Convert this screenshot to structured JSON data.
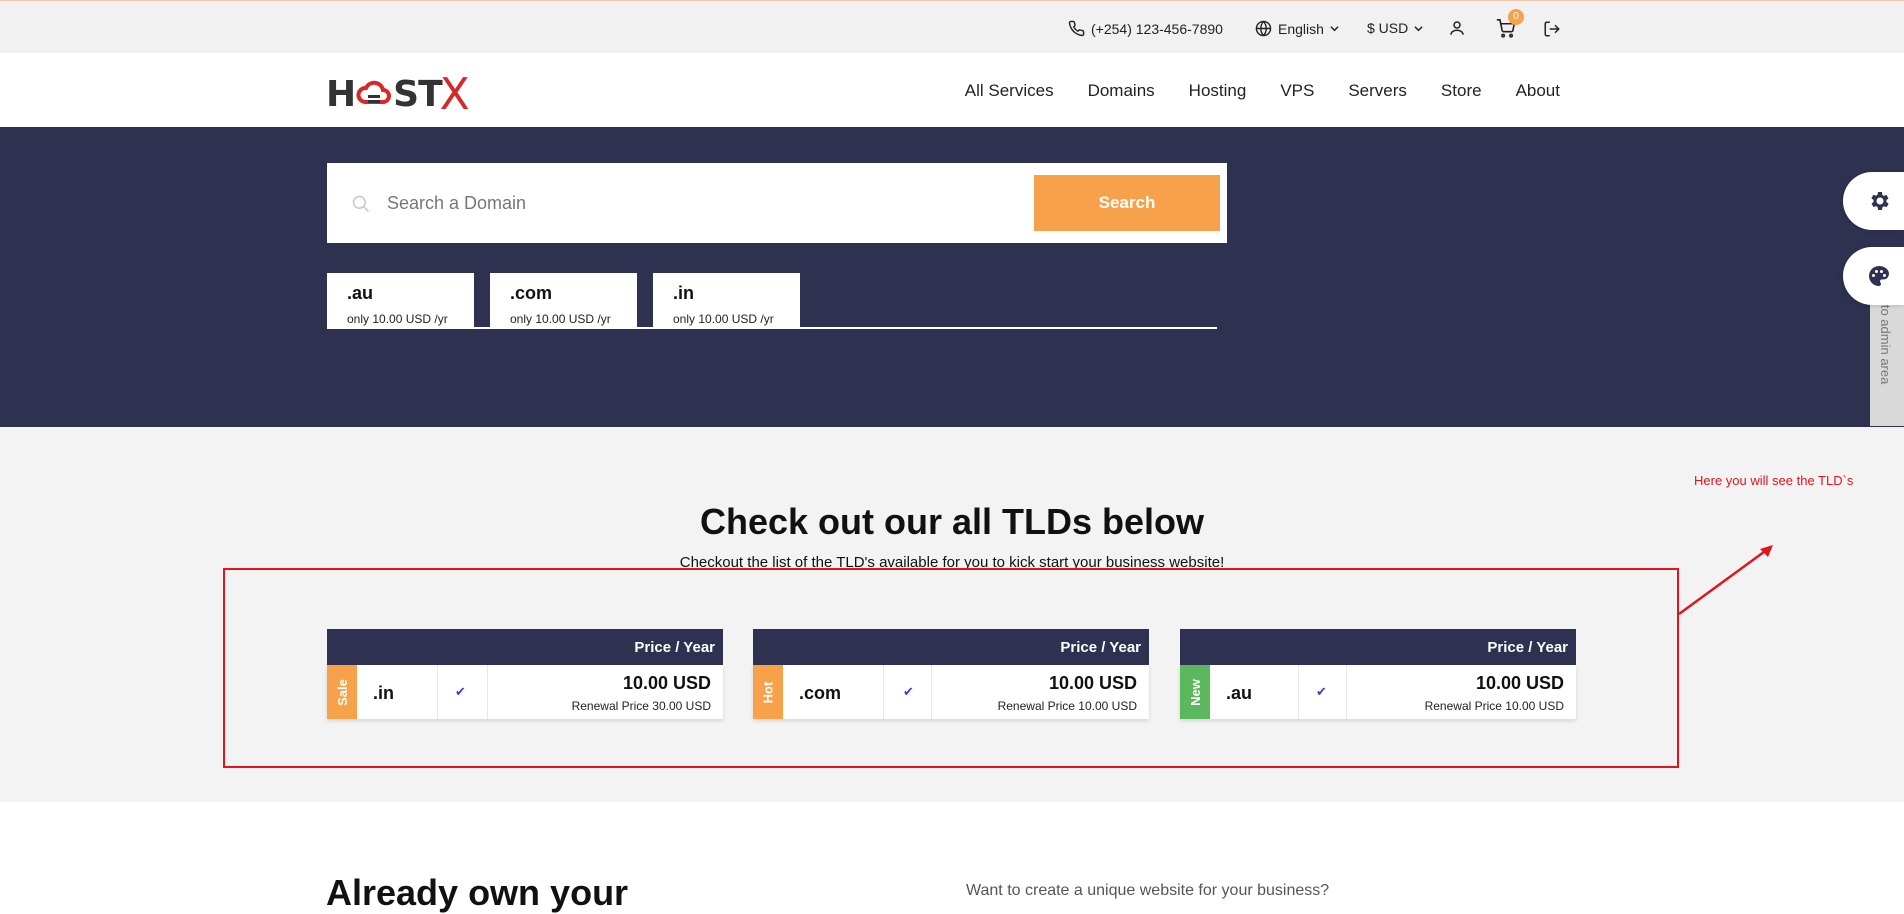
{
  "topbar": {
    "phone": "(+254) 123-456-7890",
    "language": "English",
    "currency": "$ USD",
    "cart_count": "0"
  },
  "header": {
    "logo_text_left": "H",
    "logo_text_mid": "ST",
    "logo_text_right": "X",
    "nav": [
      "All Services",
      "Domains",
      "Hosting",
      "VPS",
      "Servers",
      "Store",
      "About"
    ]
  },
  "hero": {
    "search_placeholder": "Search a Domain",
    "search_button": "Search",
    "chips": [
      {
        "ext": ".au",
        "price": "only 10.00 USD /yr"
      },
      {
        "ext": ".com",
        "price": "only 10.00 USD /yr"
      },
      {
        "ext": ".in",
        "price": "only 10.00 USD /yr"
      }
    ]
  },
  "tld_section": {
    "title": "Check out our all TLDs below",
    "subtitle": "Checkout the list of the TLD's available for you to kick start your business website!",
    "annotation": "Here you will see the TLD`s",
    "cards": [
      {
        "header": "Price / Year",
        "badge": "Sale",
        "badge_color": "#f7a24b",
        "ext": ".in",
        "price": "10.00 USD",
        "renewal": "Renewal Price 30.00 USD"
      },
      {
        "header": "Price / Year",
        "badge": "Hot",
        "badge_color": "#f7a24b",
        "ext": ".com",
        "price": "10.00 USD",
        "renewal": "Renewal Price 10.00 USD"
      },
      {
        "header": "Price / Year",
        "badge": "New",
        "badge_color": "#5cb85c",
        "ext": ".au",
        "price": "10.00 USD",
        "renewal": "Renewal Price 10.00 USD"
      }
    ]
  },
  "bottom": {
    "title": "Already own your",
    "text": "Want to create a unique website for your business?"
  },
  "side": {
    "admin_label": "n to admin area"
  },
  "colors": {
    "navy": "#2e3250",
    "orange": "#f7a24b",
    "annotation_red": "#e0161c",
    "new_green": "#5cb85c"
  }
}
